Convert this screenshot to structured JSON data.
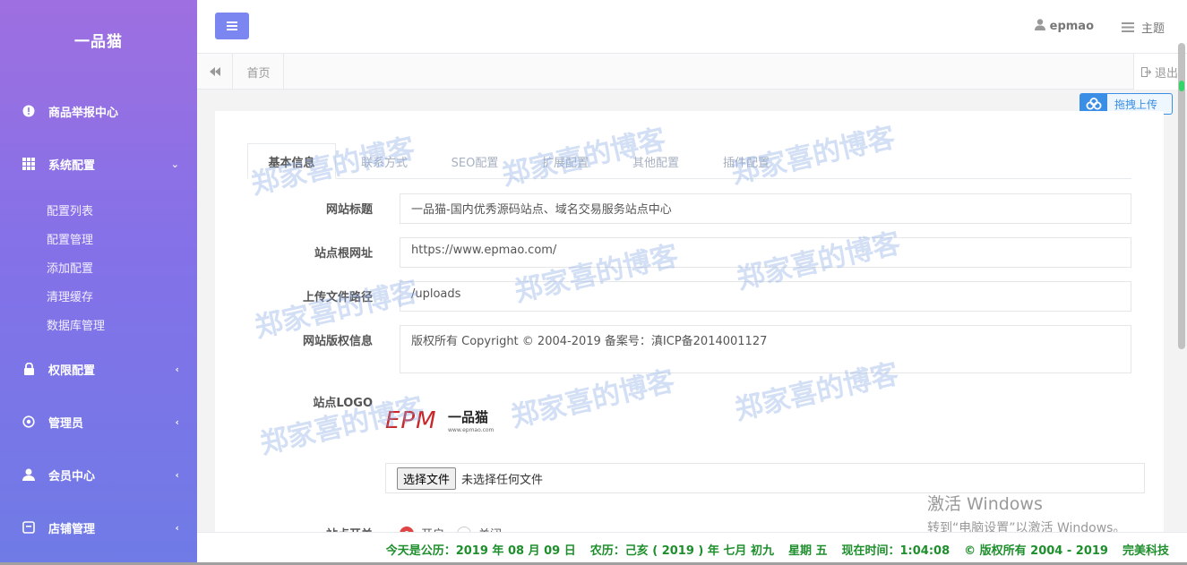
{
  "brand": "一品猫",
  "sidebar": {
    "items": [
      {
        "label": "商品举报中心",
        "icon": "info-icon",
        "arrow": ""
      },
      {
        "label": "系统配置",
        "icon": "grid-icon",
        "arrow": "⌄"
      },
      {
        "label": "权限配置",
        "icon": "lock-icon",
        "arrow": "‹"
      },
      {
        "label": "管理员",
        "icon": "target-icon",
        "arrow": "‹"
      },
      {
        "label": "会员中心",
        "icon": "user-icon",
        "arrow": "‹"
      },
      {
        "label": "店铺管理",
        "icon": "shop-icon",
        "arrow": "‹"
      }
    ],
    "sub_items": [
      "配置列表",
      "配置管理",
      "添加配置",
      "清理缓存",
      "数据库管理"
    ]
  },
  "header": {
    "user": "epmao",
    "theme": "主题"
  },
  "tabbar": {
    "home": "首页",
    "logout": "退出"
  },
  "upload_button": "拖拽上传",
  "tabs": [
    "基本信息",
    "联系方式",
    "SEO配置",
    "扩展配置",
    "其他配置",
    "插件配置"
  ],
  "form": {
    "site_title_label": "网站标题",
    "site_title_value": "一品猫-国内优秀源码站点、域名交易服务站点中心",
    "site_url_label": "站点根网址",
    "site_url_value": "https://www.epmao.com/",
    "upload_path_label": "上传文件路径",
    "upload_path_value": "/uploads",
    "copyright_label": "网站版权信息",
    "copyright_value": "版权所有 Copyright © 2004-2019 备案号：滇ICP备2014001127",
    "logo_label": "站点LOGO",
    "logo_text": "EPM",
    "logo_cn": "一品猫",
    "logo_url": "www.epmao.com",
    "file_button": "选择文件",
    "file_status": "未选择任何文件",
    "switch_label": "站点开关",
    "switch_on": "开启",
    "switch_off": "关闭"
  },
  "watermark": "郑家喜的博客",
  "activate": {
    "title": "激活 Windows",
    "subtitle": "转到“电脑设置”以激活 Windows。"
  },
  "footer": {
    "date": "今天是公历：2019 年 08 月 09 日",
    "lunar": "农历：己亥 ( 2019 ) 年  七月 初九",
    "weekday": "星期 五",
    "time": "现在时间：1:04:08",
    "copyright": "© 版权所有 2004 - 2019",
    "company": "完美科技"
  }
}
